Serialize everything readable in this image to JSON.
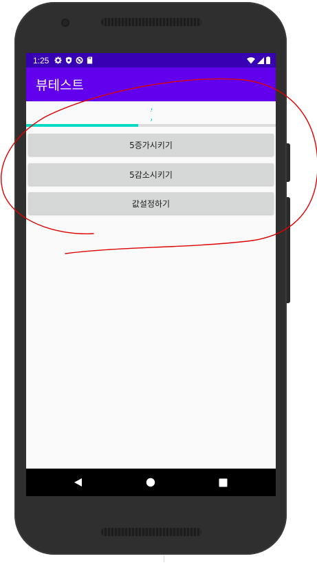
{
  "status_bar": {
    "time": "1:25",
    "left_icons": [
      "gear-icon",
      "shield-icon",
      "circle-icon",
      "sd-card-icon"
    ],
    "right_icons": [
      "wifi-icon",
      "signal-icon",
      "battery-icon"
    ],
    "background": "#3700b3"
  },
  "app_bar": {
    "title": "뷰테스트",
    "background": "#6200ee"
  },
  "seekbar": {
    "progress": 0.45,
    "fill_color": "#03dac5"
  },
  "buttons": [
    {
      "label": "5증가시키기"
    },
    {
      "label": "5감소시키기"
    },
    {
      "label": "값설정하기"
    }
  ],
  "nav_bar": {
    "icons": [
      "back-icon",
      "home-icon",
      "recents-icon"
    ]
  },
  "annotation": {
    "color": "#e00000"
  }
}
